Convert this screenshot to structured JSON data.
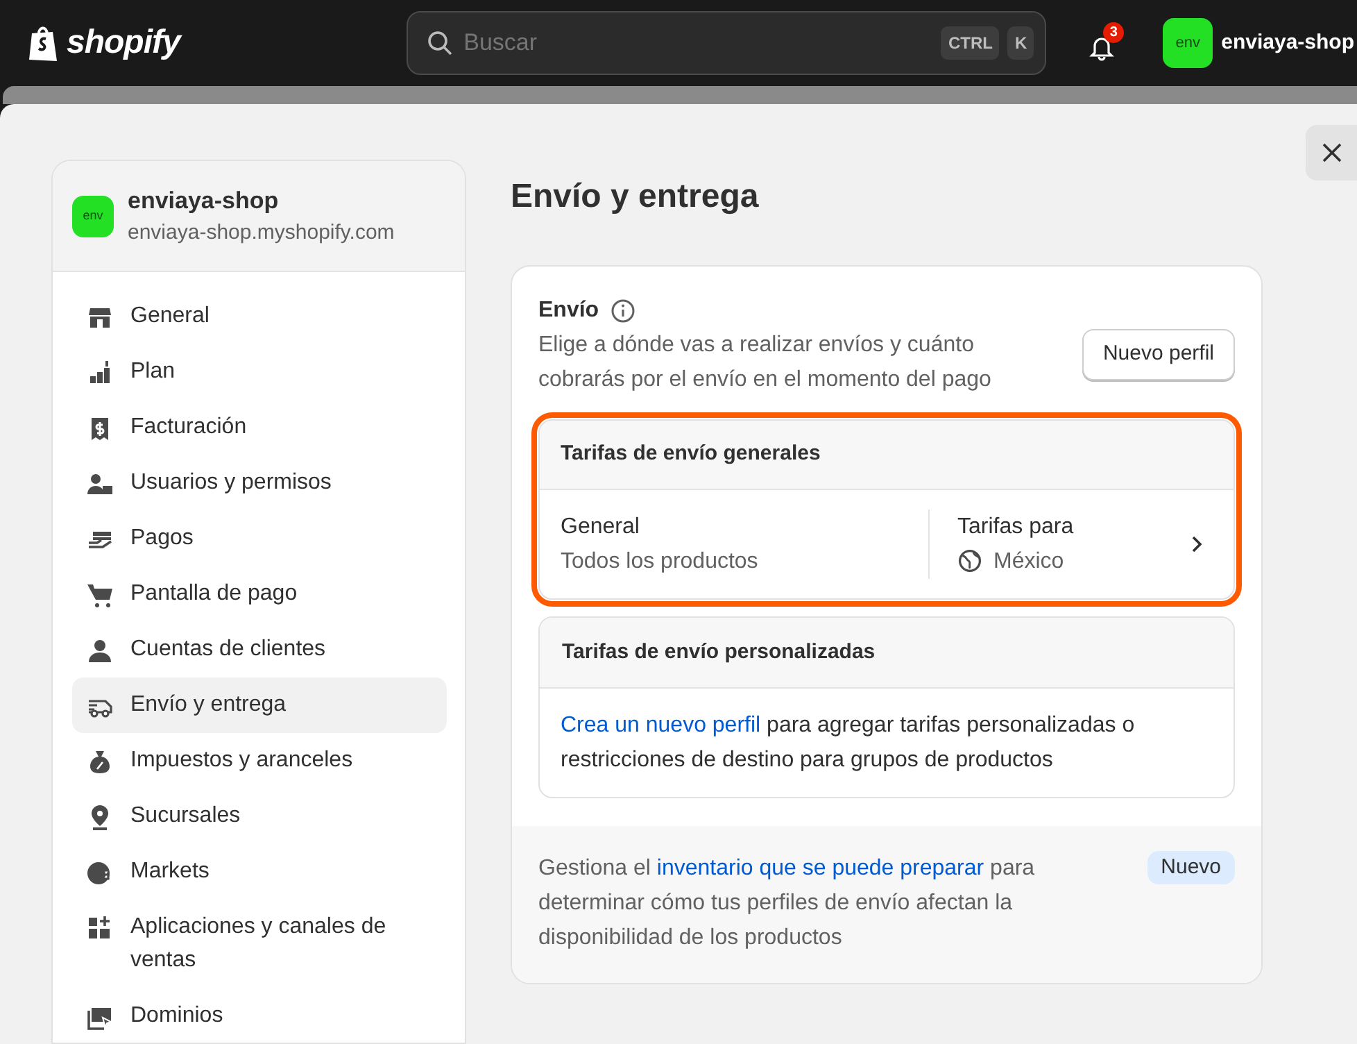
{
  "topbar": {
    "logo": "shopify",
    "search": {
      "placeholder": "Buscar",
      "keys": [
        "CTRL",
        "K"
      ]
    },
    "notifications": "3",
    "store": {
      "avatar": "env",
      "name": "enviaya-shop"
    }
  },
  "sidebar": {
    "store": {
      "avatar": "env",
      "name": "enviaya-shop",
      "domain": "enviaya-shop.myshopify.com"
    },
    "items": [
      {
        "label": "General",
        "selected": false
      },
      {
        "label": "Plan",
        "selected": false
      },
      {
        "label": "Facturación",
        "selected": false
      },
      {
        "label": "Usuarios y permisos",
        "selected": false
      },
      {
        "label": "Pagos",
        "selected": false
      },
      {
        "label": "Pantalla de pago",
        "selected": false
      },
      {
        "label": "Cuentas de clientes",
        "selected": false
      },
      {
        "label": "Envío y entrega",
        "selected": true
      },
      {
        "label": "Impuestos y aranceles",
        "selected": false
      },
      {
        "label": "Sucursales",
        "selected": false
      },
      {
        "label": "Markets",
        "selected": false
      },
      {
        "label": "Aplicaciones y canales de ventas",
        "selected": false
      },
      {
        "label": "Dominios",
        "selected": false
      }
    ]
  },
  "page": {
    "title": "Envío y entrega",
    "shipping": {
      "title": "Envío",
      "description": "Elige a dónde vas a realizar envíos y cuánto cobrarás por el envío en el momento del pago",
      "button": "Nuevo perfil",
      "general_rates": {
        "title": "Tarifas de envío generales",
        "highlighted": true,
        "profile": {
          "name": "General",
          "detail": "Todos los productos",
          "rates_label": "Tarifas para",
          "zone": "México"
        }
      },
      "custom_rates": {
        "title": "Tarifas de envío personalizadas",
        "text": "para agregar tarifas personalizadas o restricciones de destino para grupos de productos",
        "link": "Crea un nuevo perfil"
      },
      "footer": {
        "before": "Gestiona el",
        "link": "inventario que se puede preparar",
        "after": "para determinar cómo tus perfiles de envío afectan la disponibilidad de los productos",
        "badge": "Nuevo"
      }
    }
  }
}
